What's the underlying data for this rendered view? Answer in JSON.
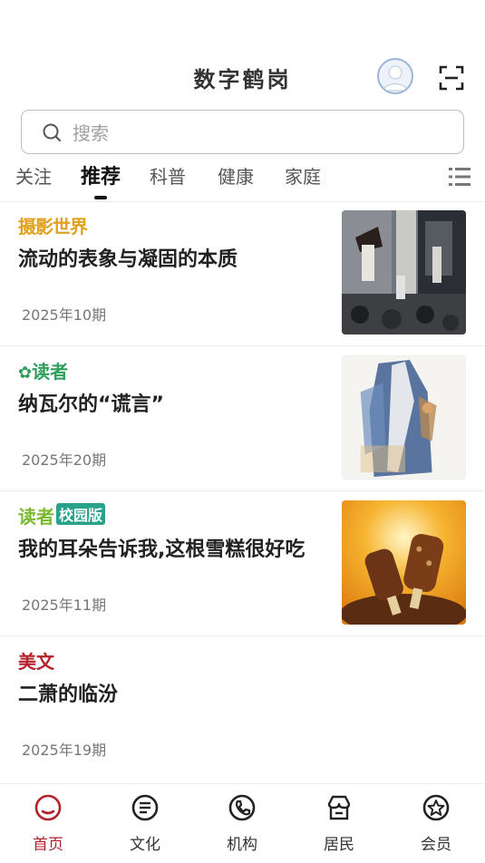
{
  "header": {
    "title": "数字鹤岗"
  },
  "search": {
    "placeholder": "搜索"
  },
  "tabs": [
    "关注",
    "推荐",
    "科普",
    "健康",
    "家庭"
  ],
  "articles": [
    {
      "source": "摄影世界",
      "source_color": "#e0a020",
      "title": "流动的表象与凝固的本质",
      "issue": "2025年10期"
    },
    {
      "source": "读者",
      "source_color": "#2e9e5b",
      "title": "纳瓦尔的“谎言”",
      "issue": "2025年20期"
    },
    {
      "source": "读者",
      "source_badge": "校园版",
      "source_color": "#7ab830",
      "title": "我的耳朵告诉我,这根雪糕很好吃",
      "issue": "2025年11期"
    },
    {
      "source": "美文",
      "source_color": "#b3212b",
      "title": "二萧的临汾",
      "issue": "2025年19期"
    }
  ],
  "nav": [
    "首页",
    "文化",
    "机构",
    "居民",
    "会员"
  ],
  "colors": {
    "accent": "#b3212b"
  }
}
